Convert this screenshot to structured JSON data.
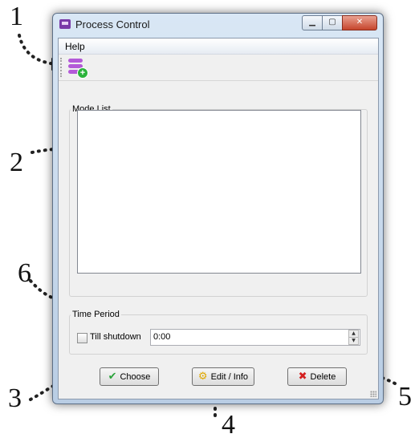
{
  "callouts": [
    "1",
    "2",
    "3",
    "4",
    "5",
    "6"
  ],
  "window": {
    "title": "Process Control",
    "app_icon": "app-window-icon",
    "controls": {
      "minimize_icon": "minimize-icon",
      "maximize_icon": "maximize-icon",
      "close_icon": "close-icon"
    }
  },
  "menu": {
    "help": "Help"
  },
  "toolbar": {
    "add_mode_icon": "add-mode-icon"
  },
  "mode_list": {
    "title": "Mode List",
    "items": []
  },
  "time_period": {
    "title": "Time Period",
    "till_shutdown_label": "Till shutdown",
    "till_shutdown_checked": false,
    "time_value": "0:00"
  },
  "buttons": {
    "choose": "Choose",
    "edit_info": "Edit / Info",
    "delete": "Delete"
  },
  "colors": {
    "accent_purple": "#b35ad8",
    "ok_green": "#2aa33a",
    "delete_red": "#d42020"
  }
}
